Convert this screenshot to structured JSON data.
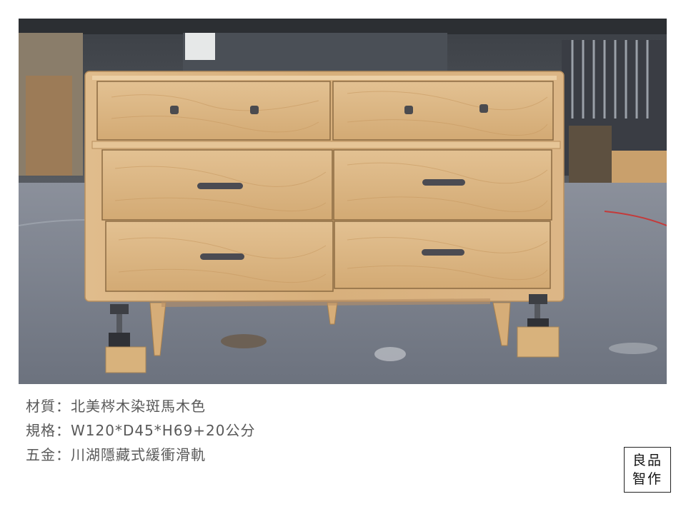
{
  "photo": {
    "subject": "oak-six-drawer-dresser"
  },
  "specs": [
    {
      "label": "材質",
      "sep": "：",
      "value": "北美梣木染斑馬木色"
    },
    {
      "label": "規格",
      "sep": "：",
      "value": "W120*D45*H69+20公分"
    },
    {
      "label": "五金",
      "sep": "：",
      "value": "川湖隱藏式緩衝滑軌"
    }
  ],
  "logo": {
    "line1": "良品",
    "line2": "智作"
  },
  "colors": {
    "wood": "#d9b382",
    "floor": "#7d838f",
    "text": "#595959"
  }
}
